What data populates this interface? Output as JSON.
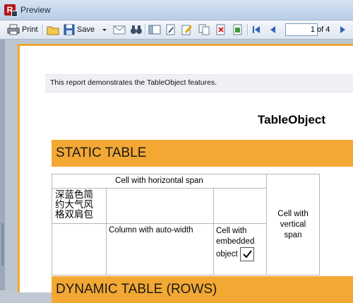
{
  "window": {
    "title": "Preview"
  },
  "toolbar": {
    "print_label": "Print",
    "save_label": "Save",
    "page_current": "1",
    "page_of": "of 4"
  },
  "report": {
    "header_text": "This report demonstrates the TableObject features.",
    "title": "TableObject",
    "section1": "STATIC TABLE",
    "section2": "DYNAMIC TABLE (ROWS)",
    "table": {
      "hspan": "Cell with horizontal span",
      "cjk": "深蓝色简约大气风格双肩包",
      "autowidth": "Column with auto-width",
      "embedded": "Cell with embedded object",
      "vspan": "Cell with vertical span"
    }
  },
  "colors": {
    "accent": "#f3a833"
  }
}
